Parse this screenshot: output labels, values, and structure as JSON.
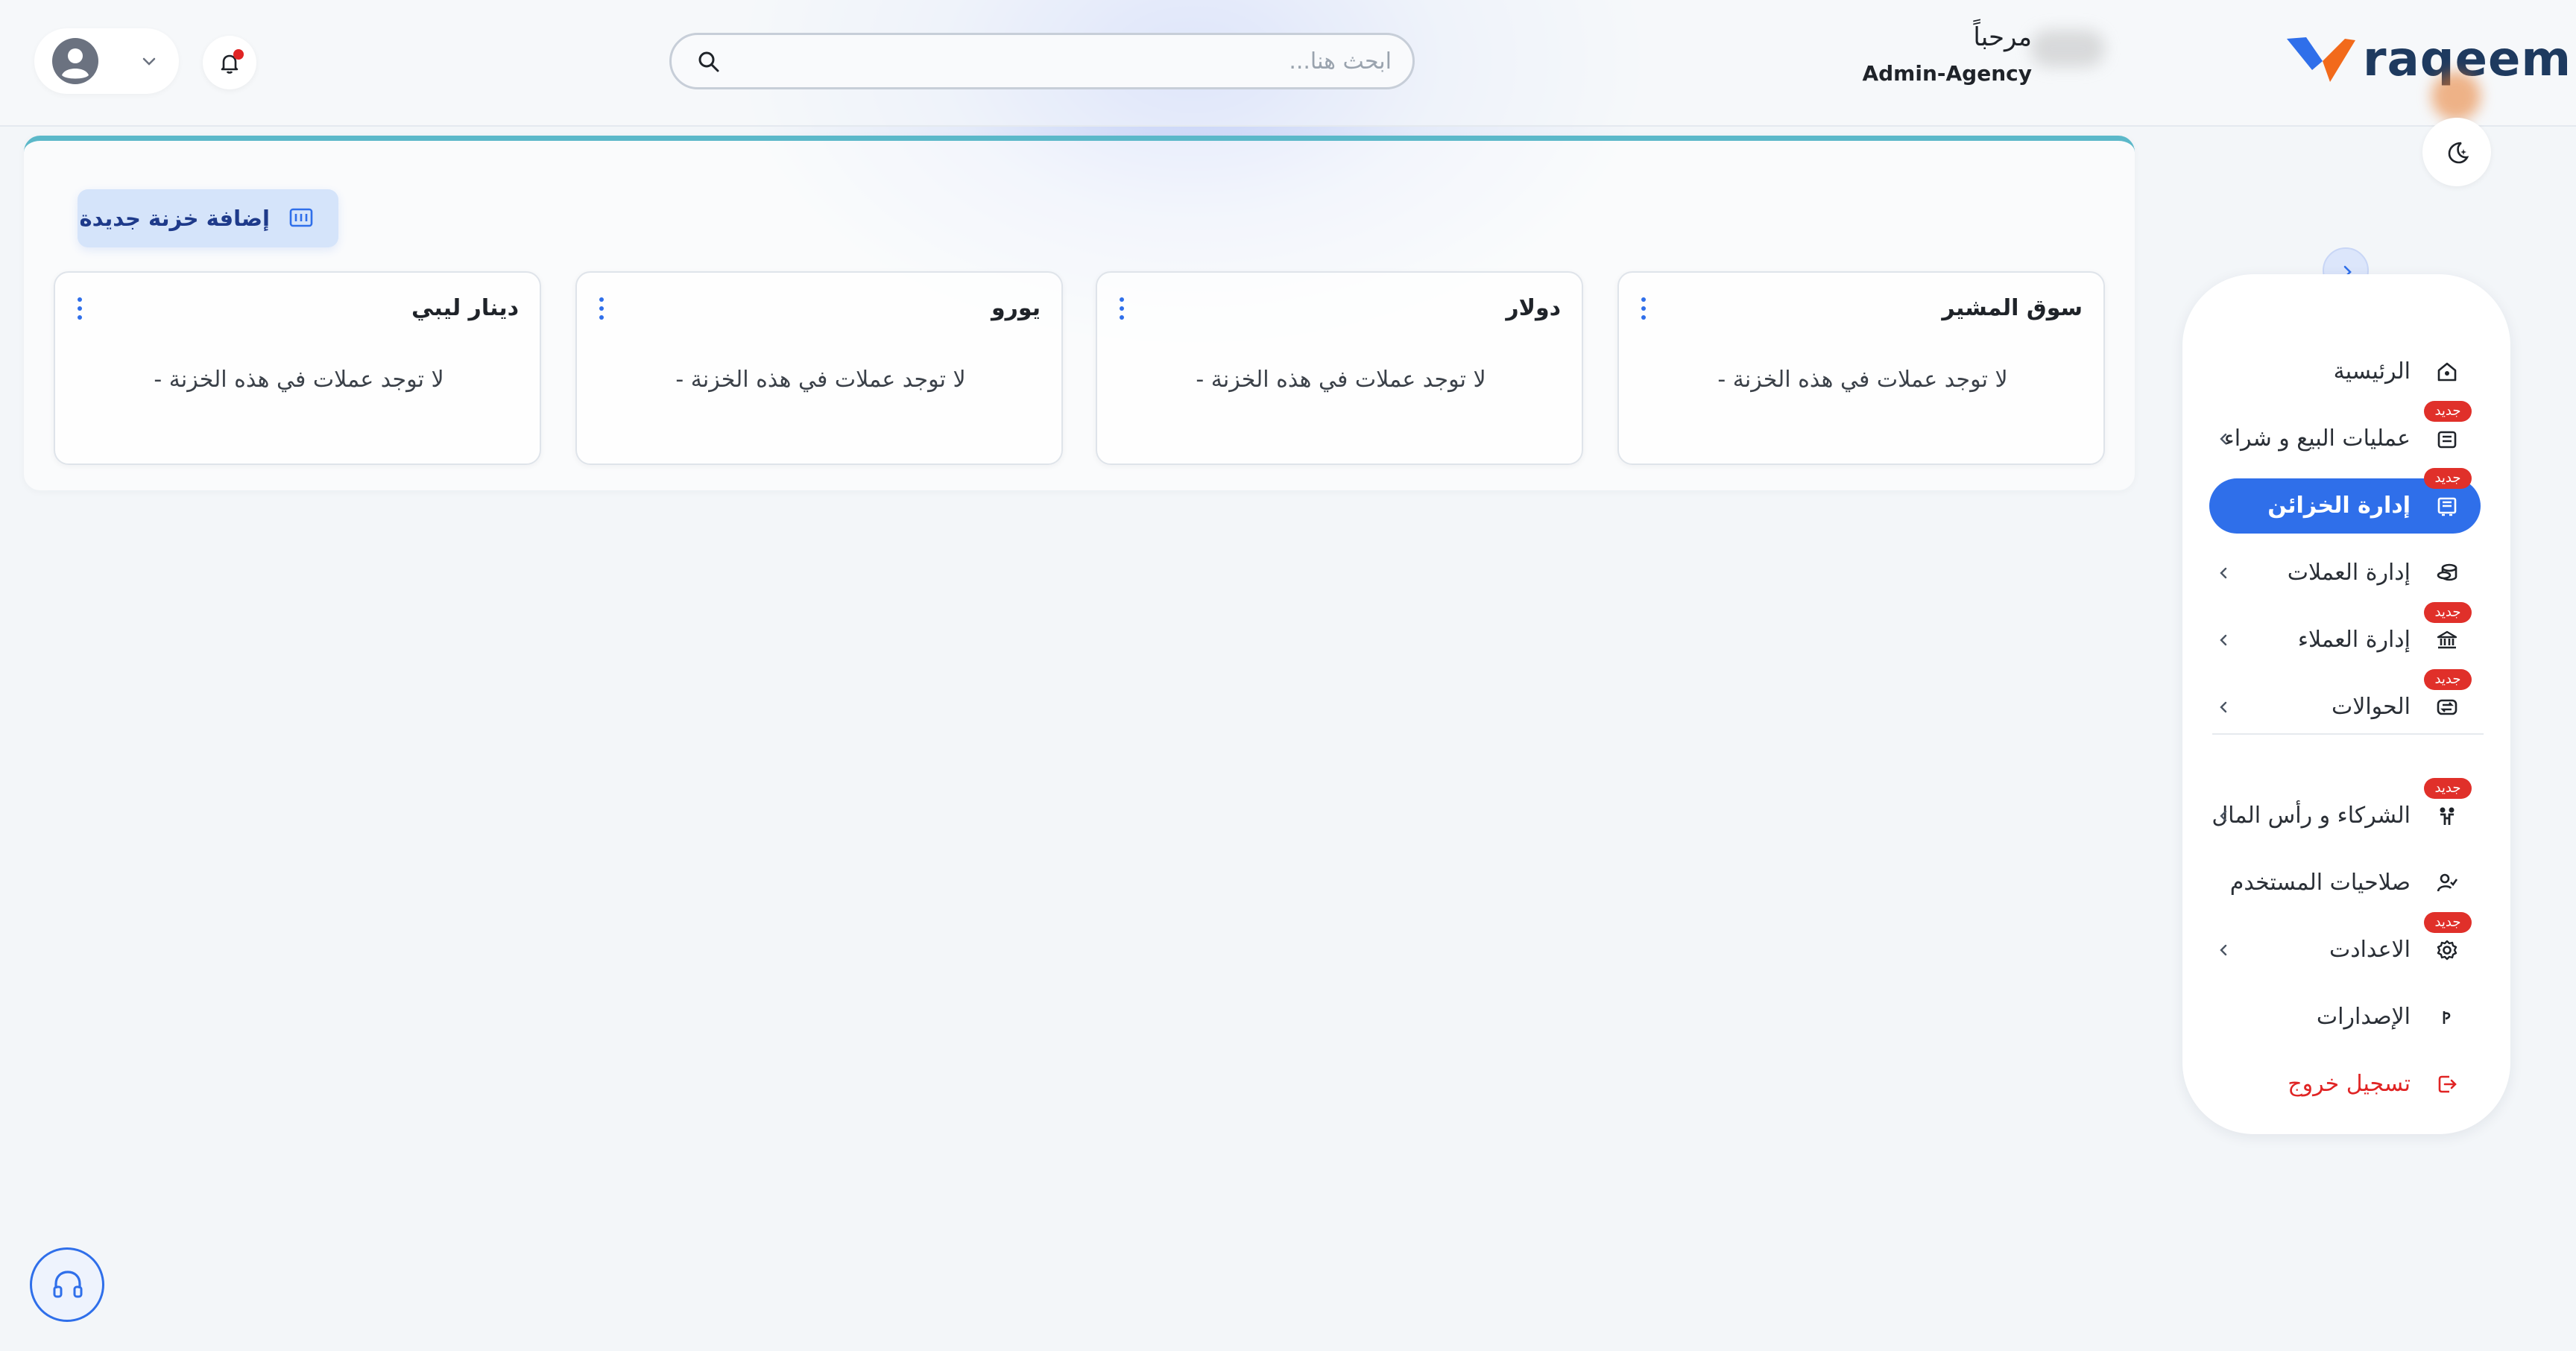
{
  "header": {
    "search_placeholder": "ابحث هنا...",
    "greeting": "مرحباً",
    "role": "Admin-Agency",
    "brand": "raqeem"
  },
  "sidebar": {
    "items": [
      {
        "label": "الرئيسية",
        "icon": "home-icon",
        "badge": "",
        "arrow": false,
        "active": false
      },
      {
        "label": "عمليات البيع و شراء",
        "icon": "exchange-icon",
        "badge": "جديد",
        "arrow": true,
        "active": false
      },
      {
        "label": "إدارة الخزائن",
        "icon": "safe-icon",
        "badge": "جديد",
        "arrow": false,
        "active": true
      },
      {
        "label": "إدارة العملات",
        "icon": "coins-icon",
        "badge": "",
        "arrow": true,
        "active": false
      },
      {
        "label": "إدارة العملاء",
        "icon": "bank-icon",
        "badge": "جديد",
        "arrow": true,
        "active": false
      },
      {
        "label": "الحوالات",
        "icon": "transfer-icon",
        "badge": "جديد",
        "arrow": true,
        "active": false
      },
      {
        "label": "الشركاء و رأس المال",
        "icon": "partners-icon",
        "badge": "جديد",
        "arrow": true,
        "active": false
      },
      {
        "label": "صلاحيات المستخدم",
        "icon": "user-permissions-icon",
        "badge": "",
        "arrow": false,
        "active": false
      },
      {
        "label": "الاعدادت",
        "icon": "settings-icon",
        "badge": "جديد",
        "arrow": true,
        "active": false
      },
      {
        "label": "الإصدارات",
        "icon": "versions-icon",
        "badge": "",
        "arrow": false,
        "active": false
      },
      {
        "label": "تسجيل خروج",
        "icon": "logout-icon",
        "badge": "",
        "arrow": false,
        "active": false
      }
    ]
  },
  "main": {
    "add_button_label": "إضافة خزنة جديدة",
    "vaults": [
      {
        "name": "سوق المشير",
        "empty_text": "لا توجد عملات في هذه الخزنة -"
      },
      {
        "name": "دولار",
        "empty_text": "لا توجد عملات في هذه الخزنة -"
      },
      {
        "name": "يورو",
        "empty_text": "لا توجد عملات في هذه الخزنة -"
      },
      {
        "name": "دينار ليبي",
        "empty_text": "لا توجد عملات في هذه الخزنة -"
      }
    ]
  },
  "colors": {
    "accent": "#2f6fea",
    "badge": "#e0302a",
    "logout": "#e02424",
    "panel_top_border": "#5bb8c9"
  }
}
